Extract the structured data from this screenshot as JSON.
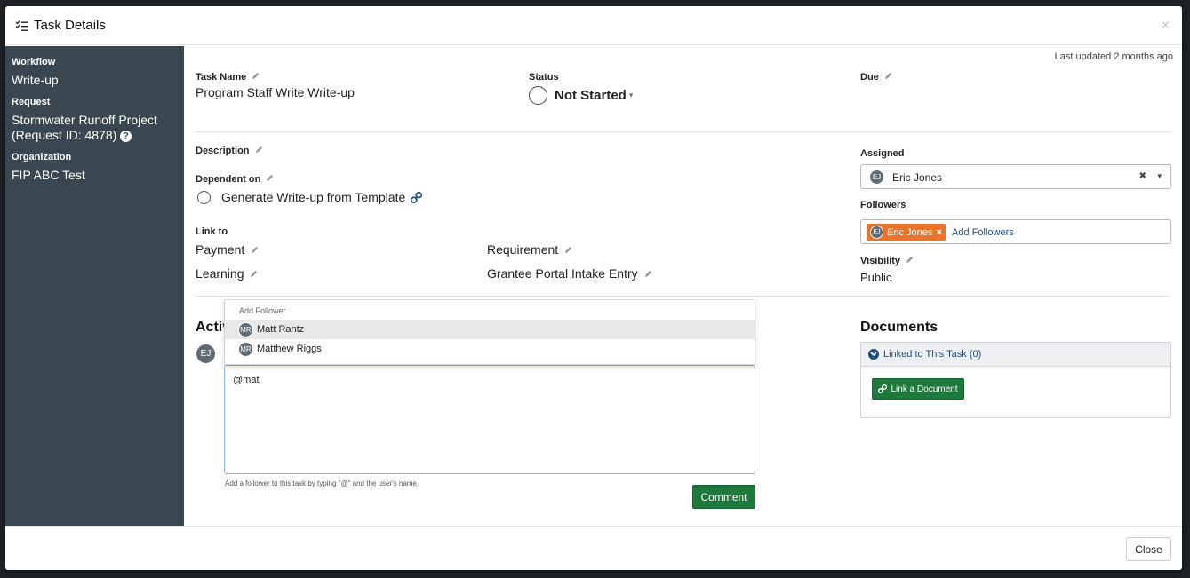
{
  "modal": {
    "title": "Task Details",
    "close_glyph": "×",
    "last_updated": "Last updated 2 months ago"
  },
  "sidebar": {
    "workflow_label": "Workflow",
    "workflow_value": "Write-up",
    "request_label": "Request",
    "request_value_line1": "Stormwater Runoff Project",
    "request_value_line2": "(Request ID: 4878)",
    "help_glyph": "?",
    "organization_label": "Organization",
    "organization_value": "FIP ABC Test"
  },
  "task": {
    "name_label": "Task Name",
    "name_value": "Program Staff Write Write-up",
    "status_label": "Status",
    "status_value": "Not Started",
    "status_caret": "▾",
    "due_label": "Due",
    "description_label": "Description",
    "dependent_label": "Dependent on",
    "dependent_item": "Generate Write-up from Template",
    "link_to_label": "Link to",
    "link_payment": "Payment",
    "link_requirement": "Requirement",
    "link_learning": "Learning",
    "link_grantee": "Grantee Portal Intake Entry"
  },
  "assigned": {
    "label": "Assigned",
    "initials": "EJ",
    "name": "Eric Jones",
    "clear_glyph": "✖",
    "caret_glyph": "▾"
  },
  "followers": {
    "label": "Followers",
    "tag_initials": "EJ",
    "tag_name": "Eric Jones",
    "tag_remove": "✖",
    "add_link": "Add Followers"
  },
  "visibility": {
    "label": "Visibility",
    "value": "Public"
  },
  "activity": {
    "heading": "Activi",
    "avatar_initials": "EJ",
    "textarea_value": "@mat",
    "help_text": "Add a follower to this task by typing \"@\" and the user's name.",
    "comment_button": "Comment",
    "dropdown": {
      "header": "Add Follower",
      "items": [
        {
          "initials": "MR",
          "name": "Matt Rantz"
        },
        {
          "initials": "MR",
          "name": "Matthew Riggs"
        }
      ]
    }
  },
  "documents": {
    "heading": "Documents",
    "panel_title": "Linked to This Task (0)",
    "link_button": "Link a Document"
  },
  "footer": {
    "close_button": "Close"
  }
}
